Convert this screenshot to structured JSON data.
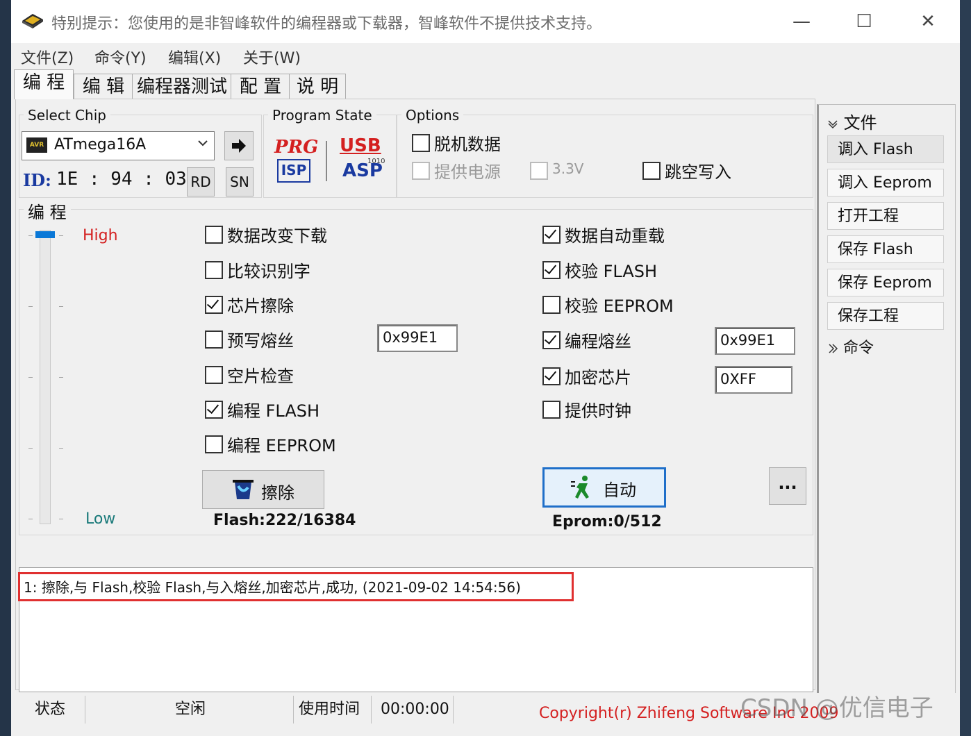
{
  "window": {
    "title": "特别提示：您使用的是非智峰软件的编程器或下载器，智峰软件不提供技术支持。",
    "controls": {
      "minimize": "—",
      "maximize": "☐",
      "close": "✕"
    }
  },
  "menu": [
    "文件(Z)",
    "命令(Y)",
    "编辑(X)",
    "关于(W)"
  ],
  "tabs": [
    "编 程",
    "编 辑",
    "编程器测试",
    "配 置",
    "说 明"
  ],
  "select_chip": {
    "group_title": "Select Chip",
    "chip_badge": "AVR",
    "chip_name": "ATmega16A",
    "id_label": "ID:",
    "id_value": "1E : 94 : 03",
    "rd_label": "RD",
    "sn_label": "SN"
  },
  "program_state": {
    "group_title": "Program State",
    "prg": "PRG",
    "isp": "ISP",
    "usb": "USB",
    "asp": "ASP",
    "bits": "1010"
  },
  "options": {
    "group_title": "Options",
    "offline_data": {
      "label": "脱机数据",
      "checked": false
    },
    "supply_power": {
      "label": "提供电源",
      "checked": false,
      "disabled": true
    },
    "v33": {
      "label": "3.3V",
      "checked": false,
      "disabled": true
    },
    "skip_blank": {
      "label": "跳空写入",
      "checked": false
    }
  },
  "program": {
    "group_title": "编 程",
    "level_high": "High",
    "level_low": "Low",
    "left_checks": [
      {
        "label": "数据改变下载",
        "checked": false
      },
      {
        "label": "比较识别字",
        "checked": false
      },
      {
        "label": "芯片擦除",
        "checked": true
      },
      {
        "label": "预写熔丝",
        "checked": false
      },
      {
        "label": "空片检查",
        "checked": false
      },
      {
        "label": "编程 FLASH",
        "checked": true
      },
      {
        "label": "编程 EEPROM",
        "checked": false
      }
    ],
    "right_checks": [
      {
        "label": "数据自动重载",
        "checked": true
      },
      {
        "label": "校验 FLASH",
        "checked": true
      },
      {
        "label": "校验 EEPROM",
        "checked": false
      },
      {
        "label": "编程熔丝",
        "checked": true
      },
      {
        "label": "加密芯片",
        "checked": true
      },
      {
        "label": "提供时钟",
        "checked": false
      }
    ],
    "prewrite_fuse_value": "0x99E1",
    "program_fuse_value": "0x99E1",
    "lock_value": "0XFF",
    "erase_button": "擦除",
    "auto_button": "自动",
    "more_button": "...",
    "flash_usage": "Flash:222/16384",
    "eeprom_usage": "Eprom:0/512"
  },
  "log": {
    "line1": "1: 擦除,与 Flash,校验 Flash,与入熔丝,加密芯片,成功, (2021-09-02 14:54:56)",
    "highlight_color": "#e03030"
  },
  "right_panel": {
    "file_header": "文件",
    "buttons": [
      "调入 Flash",
      "调入 Eeprom",
      "打开工程",
      "保存 Flash",
      "保存 Eeprom",
      "保存工程"
    ],
    "command_header": "命令"
  },
  "statusbar": {
    "status_label": "状态",
    "status_value": "空闲",
    "time_label": "使用时间",
    "time_value": "00:00:00",
    "copyright": "Copyright(r) Zhifeng Software Inc 2009",
    "watermark": "CSDN @优信电子"
  },
  "colors": {
    "accent_red": "#d42020",
    "blue_id": "#1a3aa0",
    "auto_border": "#1f6fc9"
  }
}
